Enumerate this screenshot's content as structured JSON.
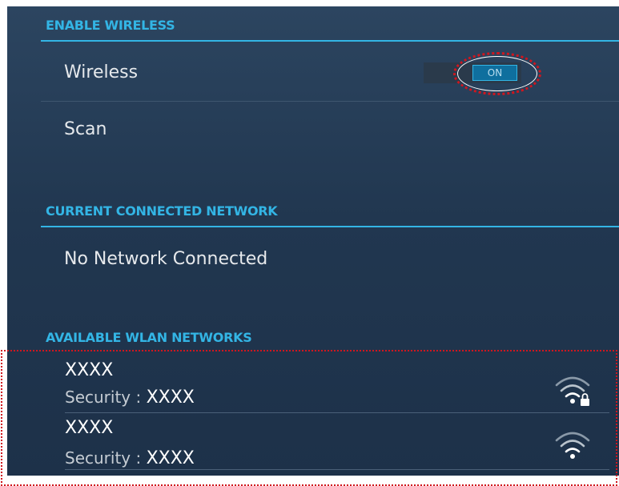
{
  "sections": {
    "enable_wireless": {
      "header": "ENABLE WIRELESS",
      "wireless_label": "Wireless",
      "toggle_label": "ON",
      "scan_label": "Scan"
    },
    "current_network": {
      "header": "CURRENT CONNECTED NETWORK",
      "status": "No Network Connected"
    },
    "available_networks": {
      "header": "AVAILABLE WLAN NETWORKS",
      "networks": [
        {
          "name": "XXXX",
          "security_label": "Security :",
          "security_value": "XXXX",
          "icon": "wifi-locked-icon"
        },
        {
          "name": "XXXX",
          "security_label": "Security :",
          "security_value": "XXXX",
          "icon": "wifi-icon"
        }
      ]
    }
  },
  "colors": {
    "accent": "#33b5e5",
    "highlight": "#d0161e",
    "background": "#213750"
  }
}
